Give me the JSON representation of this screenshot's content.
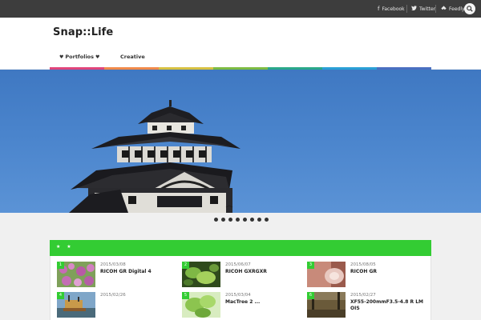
{
  "social": {
    "facebook": "Facebook",
    "twitter": "Twitter",
    "feedly": "Feedly"
  },
  "site": {
    "title": "Snap::Life"
  },
  "nav": {
    "items": [
      {
        "label": "Portfolios"
      },
      {
        "label": "Creative"
      }
    ]
  },
  "stripe_colors": [
    "#e0457b",
    "#f08a4b",
    "#d7c142",
    "#7dbb42",
    "#2aa889",
    "#2a9fd6",
    "#4a6fc1"
  ],
  "slider": {
    "dot_count": 8
  },
  "panel": {
    "header_marks": "★ ★"
  },
  "posts": [
    {
      "num": "1",
      "date": "2015/03/08",
      "title": "RICOH GR Digital 4"
    },
    {
      "num": "2",
      "date": "2015/06/07",
      "title": "RICOH GXRGXR"
    },
    {
      "num": "3",
      "date": "2015/08/05",
      "title": "RICOH GR"
    },
    {
      "num": "4",
      "date": "2015/02/26",
      "title": ""
    },
    {
      "num": "5",
      "date": "2015/03/04",
      "title": "MacTree 2 ..."
    },
    {
      "num": "6",
      "date": "2015/02/27",
      "title": "XF55-200mmF3.5-4.8 R LM OIS"
    }
  ]
}
